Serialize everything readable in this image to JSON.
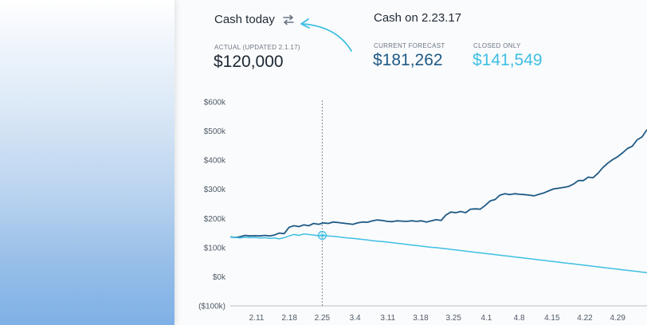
{
  "header": {
    "cash_today_title": "Cash today",
    "actual_label": "ACTUAL (UPDATED 2.1.17)",
    "actual_value": "$120,000",
    "cash_on_title": "Cash on 2.23.17",
    "forecast_label": "CURRENT FORECAST",
    "forecast_value": "$181,262",
    "closed_label": "CLOSED ONLY",
    "closed_value": "$141,549"
  },
  "icons": {
    "swap": "swap-arrows-icon",
    "annotation": "curved-arrow-icon"
  },
  "colors": {
    "forecast": "#1e5a86",
    "closed": "#3fbfe3",
    "marker": "#3fbfe3"
  },
  "chart_data": {
    "type": "line",
    "y_ticks": [
      "$600k",
      "$500k",
      "$400k",
      "$300k",
      "$200k",
      "$100k",
      "$0k",
      "($100k)"
    ],
    "ylim": [
      -100,
      600
    ],
    "x_ticks": [
      "2.11",
      "2.18",
      "2.25",
      "3.4",
      "3.11",
      "3.18",
      "3.25",
      "4.1",
      "4.8",
      "4.15",
      "4.22",
      "4.29"
    ],
    "marker_x": "2.25",
    "series": [
      {
        "key": "forecast",
        "x": [
          0,
          1,
          2,
          3,
          4,
          5,
          6,
          7,
          8,
          9,
          10,
          11,
          12,
          13,
          14,
          15,
          16,
          17,
          18,
          19,
          20,
          21,
          22,
          23,
          24,
          25,
          26,
          27,
          28,
          29,
          30,
          31,
          32,
          33,
          34,
          35,
          36,
          37,
          38,
          39,
          40,
          41,
          42,
          43,
          44,
          45,
          46,
          47,
          48,
          49,
          50,
          51,
          52,
          53,
          54,
          55,
          56,
          57,
          58,
          59,
          60,
          61,
          62,
          63,
          64,
          65,
          66,
          67,
          68,
          69,
          70,
          71,
          72,
          73,
          74,
          75,
          76,
          77,
          78,
          79,
          80,
          81,
          82,
          83,
          84,
          85
        ],
        "values": [
          137,
          135,
          137,
          142,
          140,
          141,
          140,
          142,
          140,
          143,
          150,
          148,
          170,
          175,
          172,
          178,
          175,
          183,
          180,
          185,
          183,
          188,
          186,
          184,
          182,
          180,
          185,
          188,
          187,
          192,
          195,
          193,
          190,
          189,
          192,
          191,
          190,
          192,
          190,
          192,
          188,
          192,
          196,
          193,
          212,
          222,
          220,
          224,
          220,
          232,
          233,
          232,
          245,
          260,
          265,
          280,
          285,
          282,
          285,
          283,
          282,
          280,
          278,
          283,
          288,
          295,
          302,
          304,
          307,
          310,
          318,
          330,
          330,
          342,
          340,
          355,
          375,
          390,
          402,
          412,
          425,
          440,
          448,
          470,
          480,
          505
        ]
      },
      {
        "key": "closed",
        "x": [
          0,
          1,
          2,
          3,
          4,
          5,
          6,
          7,
          8,
          9,
          10,
          11,
          12,
          13,
          14,
          15,
          16,
          17,
          18,
          19,
          20,
          21,
          22,
          23,
          24,
          25,
          26,
          27,
          28,
          29,
          30,
          31,
          32,
          33,
          34,
          35,
          36,
          37,
          38,
          39,
          40,
          41,
          42,
          43,
          44,
          45,
          46,
          47,
          48,
          49,
          50,
          51,
          52,
          53,
          54,
          55,
          56,
          57,
          58,
          59,
          60,
          61,
          62,
          63,
          64,
          65,
          66,
          67,
          68,
          69,
          70,
          71,
          72,
          73,
          74,
          75,
          76,
          77,
          78,
          79,
          80,
          81,
          82,
          83,
          84,
          85
        ],
        "values": [
          137,
          135,
          133,
          136,
          134,
          135,
          133,
          134,
          132,
          133,
          130,
          134,
          140,
          145,
          142,
          147,
          145,
          143,
          141,
          142,
          140,
          139,
          137,
          135,
          133,
          132,
          130,
          128,
          126,
          124,
          122,
          121,
          119,
          117,
          115,
          113,
          111,
          109,
          107,
          105,
          103,
          101,
          100,
          98,
          96,
          94,
          92,
          90,
          88,
          86,
          84,
          82,
          80,
          78,
          76,
          74,
          72,
          70,
          68,
          66,
          64,
          62,
          60,
          58,
          56,
          54,
          52,
          50,
          48,
          46,
          44,
          42,
          40,
          38,
          36,
          34,
          32,
          30,
          28,
          26,
          24,
          22,
          20,
          18,
          16,
          14
        ]
      }
    ]
  }
}
